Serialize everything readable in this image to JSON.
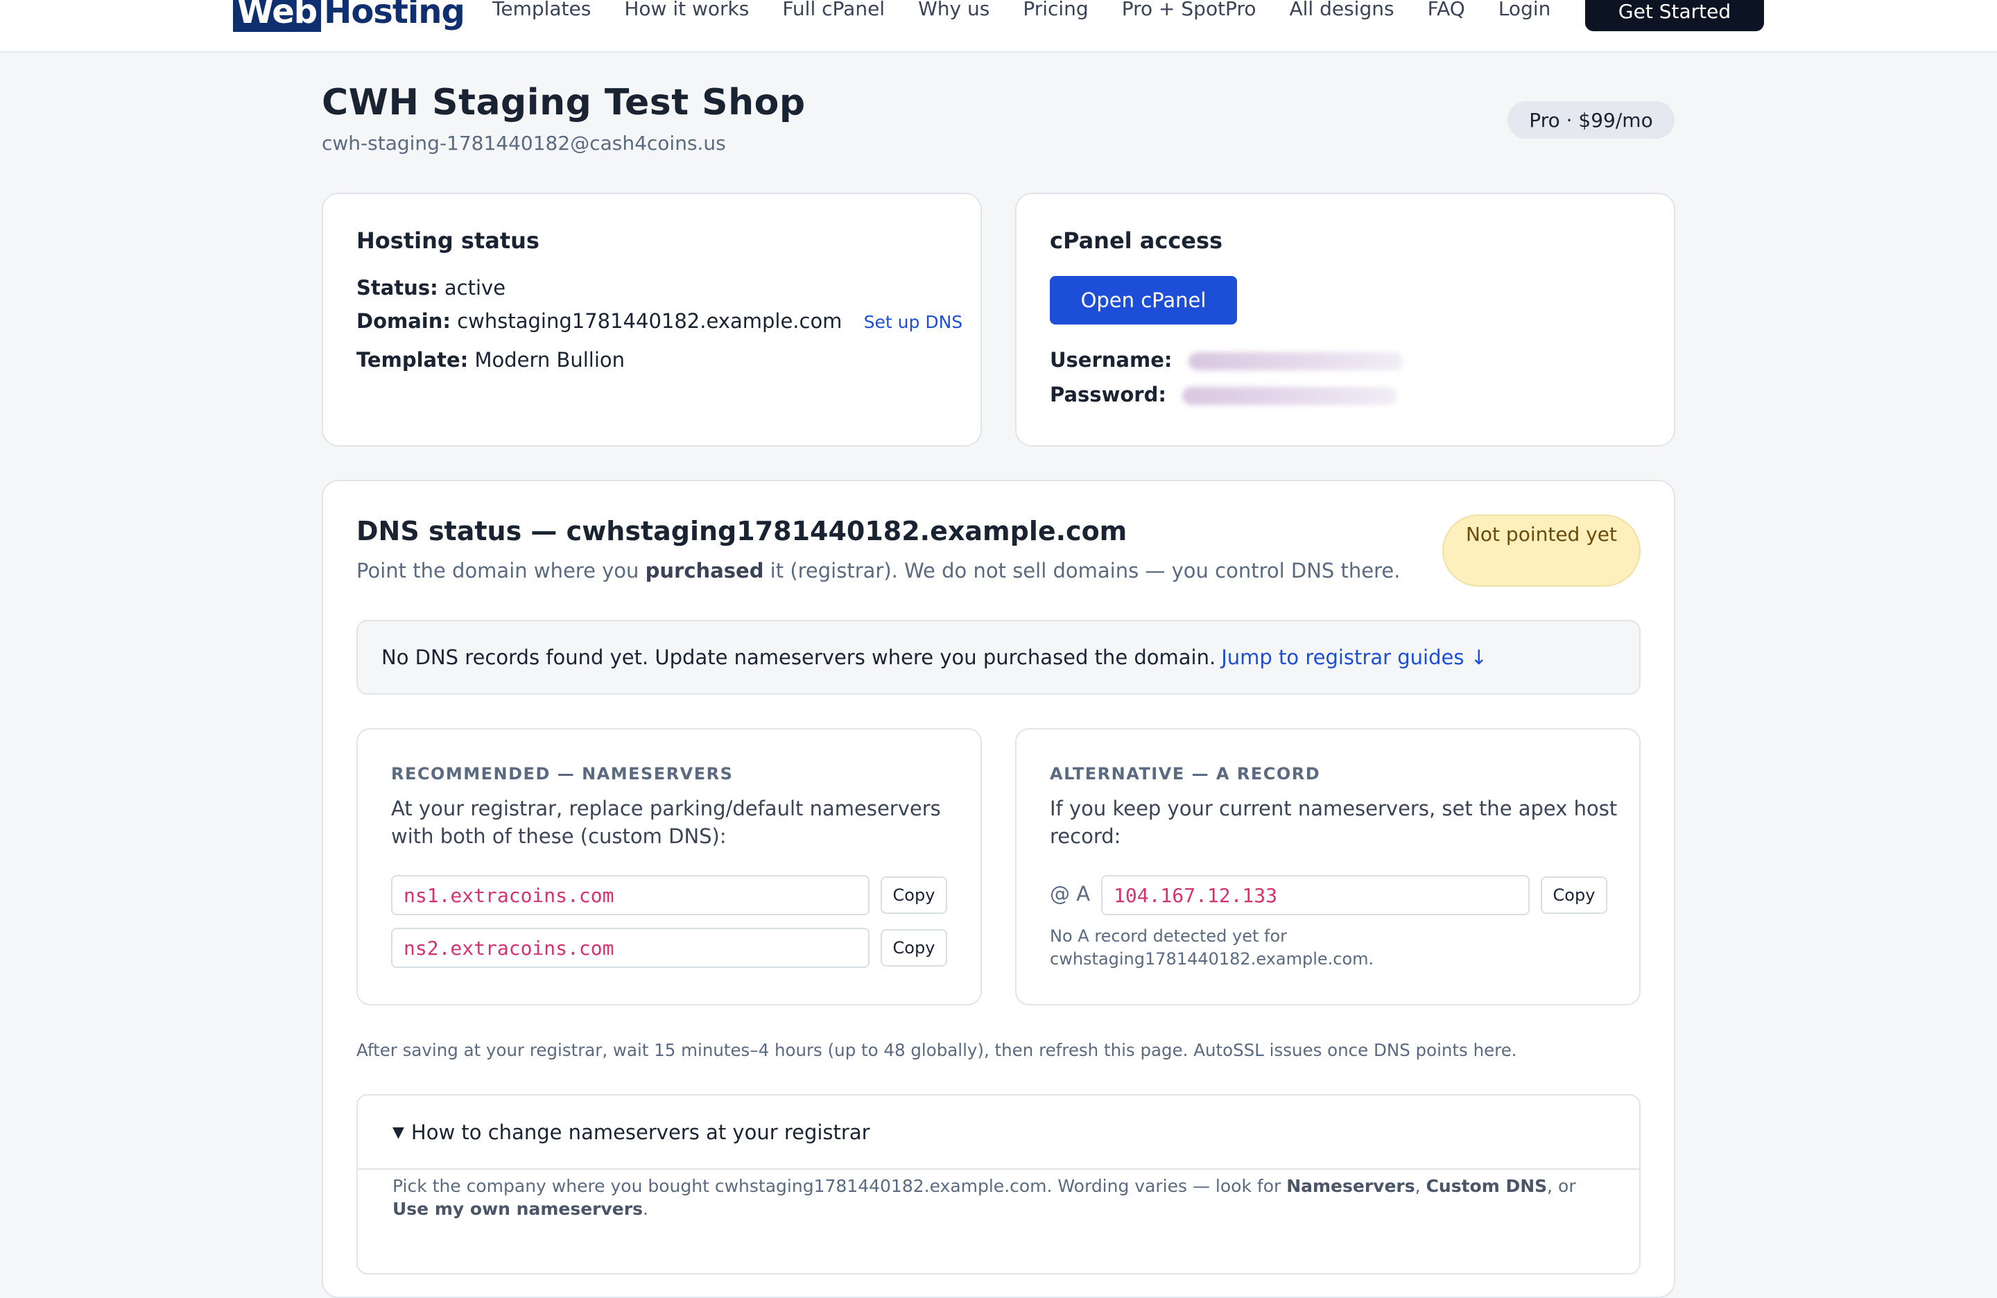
{
  "header": {
    "logo_part1": "Web",
    "logo_part2": "Hosting",
    "nav": [
      "Templates",
      "How it works",
      "Full cPanel",
      "Why us",
      "Pricing",
      "Pro + SpotPro",
      "All designs",
      "FAQ",
      "Login"
    ],
    "cta": "Get Started"
  },
  "shop": {
    "name": "CWH Staging Test Shop",
    "email": "cwh-staging-1781440182@cash4coins.us",
    "plan": "Pro · $99/mo"
  },
  "hosting": {
    "title": "Hosting status",
    "status_label": "Status:",
    "status_value": "active",
    "domain_label": "Domain:",
    "domain_value": "cwhstaging1781440182.example.com",
    "setup_dns": "Set up DNS",
    "template_label": "Template:",
    "template_value": "Modern Bullion"
  },
  "cpanel": {
    "title": "cPanel access",
    "open_button": "Open cPanel",
    "username_label": "Username:",
    "password_label": "Password:"
  },
  "dns": {
    "title": "DNS status — cwhstaging1781440182.example.com",
    "sub_before": "Point the domain where you ",
    "sub_bold": "purchased",
    "sub_after": " it (registrar). We do not sell domains — you control DNS there.",
    "badge": "Not pointed yet",
    "alert_text": "No DNS records found yet. Update nameservers where you purchased the domain.",
    "alert_link": "Jump to registrar guides ↓",
    "recommended": {
      "eyebrow": "RECOMMENDED — NAMESERVERS",
      "desc": "At your registrar, replace parking/default nameservers with both of these (custom DNS):",
      "ns1": "ns1.extracoins.com",
      "ns2": "ns2.extracoins.com",
      "copy": "Copy"
    },
    "alternative": {
      "eyebrow": "ALTERNATIVE — A RECORD",
      "desc": "If you keep your current nameservers, set the apex host record:",
      "host_label": "@ A",
      "ip": "104.167.12.133",
      "copy": "Copy",
      "note": "No A record detected yet for cwhstaging1781440182.example.com."
    },
    "after_note": "After saving at your registrar, wait 15 minutes–4 hours (up to 48 globally), then refresh this page. AutoSSL issues once DNS points here.",
    "guide": {
      "summary": "How to change nameservers at your registrar",
      "body_1": "Pick the company where you bought cwhstaging1781440182.example.com. Wording varies — look for ",
      "body_b1": "Nameservers",
      "body_2": ", ",
      "body_b2": "Custom DNS",
      "body_3": ", or ",
      "body_b3": "Use my own nameservers",
      "body_4": "."
    }
  }
}
